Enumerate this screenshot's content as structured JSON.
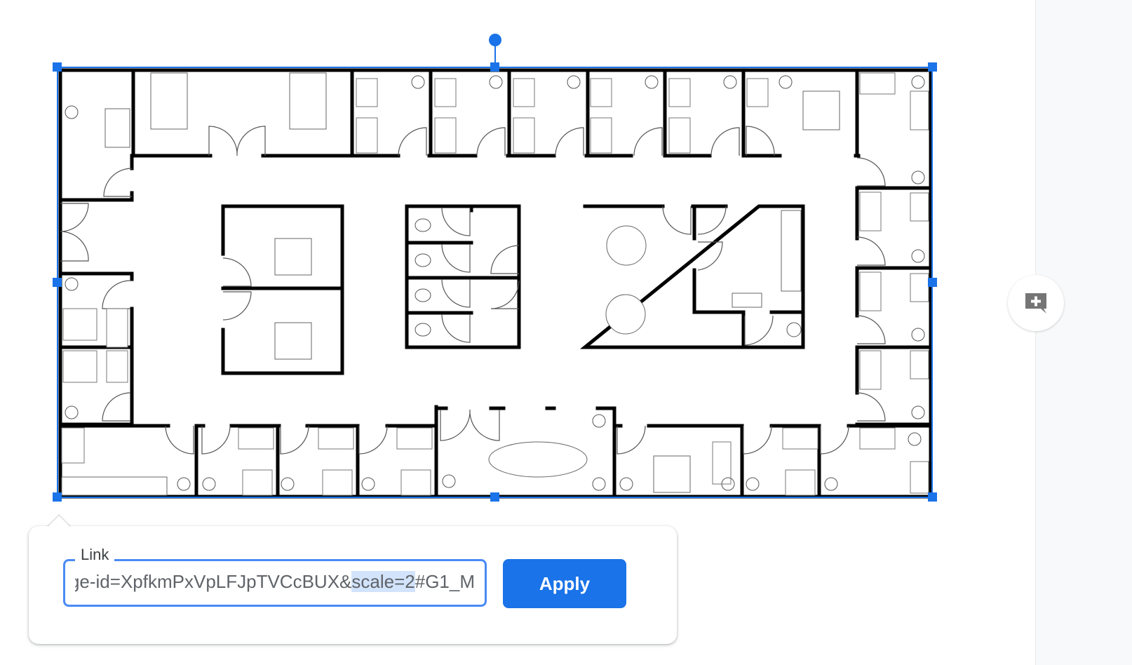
{
  "canvas": {
    "image_description": "Office floor plan drawing (selected image)",
    "selection_color": "#1a73e8"
  },
  "link_popup": {
    "field_label": "Link",
    "value_prefix": "ge-id=XpfkmPxVpLFJpTVCcBUX&",
    "value_selected": "scale=2",
    "value_suffix": "#G1_M",
    "apply_label": "Apply"
  },
  "side_panel": {
    "add_comment_icon": "add-comment-icon"
  }
}
